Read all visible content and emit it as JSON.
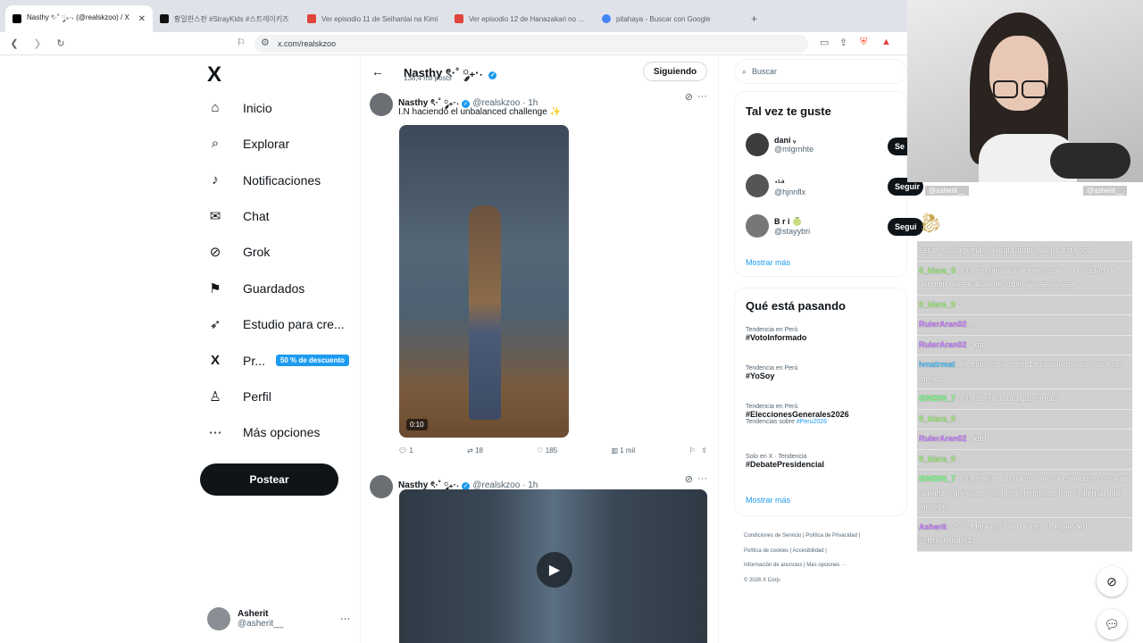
{
  "browser": {
    "tabs": [
      {
        "title": "Nasthy ৎ·˚ ༘₊·˖ (@realskzoo) / X",
        "active": true,
        "fav_color": "#000000"
      },
      {
        "title": "황밀한스판 #StrayKids #스트레이키즈",
        "active": false,
        "fav_color": "#111111"
      },
      {
        "title": "Ver episodio 11 de Seihantai na Kimi",
        "active": false,
        "fav_color": "#e0443a"
      },
      {
        "title": "Ver episodio 12 de Hanazakari no Kimi",
        "active": false,
        "fav_color": "#e0443a"
      },
      {
        "title": "pitahaya - Buscar con Google",
        "active": false,
        "fav_color": "#4285f4"
      }
    ],
    "new_tab": "+",
    "url": "x.com/realskzoo"
  },
  "nav": {
    "logo": "X",
    "items": [
      {
        "label": "Inicio",
        "icon": "⌂"
      },
      {
        "label": "Explorar",
        "icon": "⌕"
      },
      {
        "label": "Notificaciones",
        "icon": "♪"
      },
      {
        "label": "Chat",
        "icon": "✉"
      },
      {
        "label": "Grok",
        "icon": "⊘"
      },
      {
        "label": "Guardados",
        "icon": "⚑"
      },
      {
        "label": "Estudio para cre...",
        "icon": "➶"
      },
      {
        "label": "Pr...",
        "icon": "X",
        "badge": "50 % de descuento"
      },
      {
        "label": "Perfil",
        "icon": "♙"
      },
      {
        "label": "Más opciones",
        "icon": "⋯"
      }
    ],
    "post_button": "Postear",
    "account": {
      "name": "Asherit",
      "handle": "@asherit__",
      "more": "···"
    }
  },
  "profile": {
    "name": "Nasthy ৎ·˚ ༘₊·˖",
    "posts": "138,4 mil posts",
    "follow_label": "Siguiendo"
  },
  "tweets": [
    {
      "name": "Nasthy ৎ·˚ ༘₊·˖",
      "handle": "@realskzoo",
      "time": "· 1h",
      "text": "I.N haciendo el unbalanced challenge ✨",
      "duration": "0:10",
      "replies": "1",
      "retweets": "18",
      "likes": "185",
      "views": "1 mil"
    },
    {
      "name": "Nasthy ৎ·˚ ༘₊·˖",
      "handle": "@realskzoo",
      "time": "· 1h"
    }
  ],
  "sidebar": {
    "search_placeholder": "Buscar",
    "suggest_title": "Tal vez te guste",
    "suggestions": [
      {
        "name": "dani ᵥ",
        "handle": "@mlgrnhte",
        "button": "Se"
      },
      {
        "name": "･ᴸᵃ",
        "handle": "@hjnnflx",
        "button": "Seguir"
      },
      {
        "name": "B r i 🍈",
        "handle": "@stayybri",
        "button": "Segui"
      }
    ],
    "show_more": "Mostrar más",
    "trends_title": "Qué está pasando",
    "trends": [
      {
        "context": "Tendencia en Perú",
        "topic": "#VotoInformado"
      },
      {
        "context": "Tendencia en Perú",
        "topic": "#YoSoy"
      },
      {
        "context": "Tendencia en Perú",
        "topic": "#EleccionesGenerales2026",
        "sub_prefix": "Tendencias sobre",
        "sub_link": "#Peru2026"
      },
      {
        "context": "Solo en X · Tendencia",
        "topic": "#DebatePresidencial"
      }
    ],
    "trends_more": "Mostrar más",
    "footer": [
      "Condiciones de Servicio  |  Política de Privacidad  |",
      "Política de cookies  |  Accesibilidad  |",
      "Información de anuncios  |  Más opciones ···",
      "© 2026 X Corp."
    ]
  },
  "stream": {
    "cam_labels": [
      "@asherit__",
      "@asherit__"
    ],
    "chat": [
      {
        "user": "",
        "text": "secar sus lágrimas, asegurando que no esta sola",
        "color": "#ffffff"
      },
      {
        "user": "0_kiara_0",
        "text": ": @Asherit jajajaja tienes que ver el video de Jeongin que acaban de subir ajjajajajajajaja",
        "color": "#9ef07a"
      },
      {
        "user": "0_kiara_0",
        "text": ":",
        "color": "#9ef07a"
      },
      {
        "user": "RulerAran02",
        "text": ": ..",
        "color": "#c77dff"
      },
      {
        "user": "RulerAran02",
        "text": ": xdd",
        "color": "#c77dff"
      },
      {
        "user": "lvnatrmat",
        "text": ": hemos visto comp 15 conciertos en vivo esos meses",
        "color": "#4fc3ff"
      },
      {
        "user": "BINBIN_7",
        "text": ": @Asherit ahora que sigue?",
        "color": "#7dff8a"
      },
      {
        "user": "0_kiara_0",
        "text": ":",
        "color": "#9ef07a"
      },
      {
        "user": "RulerAran02",
        "text": ": xdd",
        "color": "#c77dff"
      },
      {
        "user": "0_kiara_0",
        "text": ":",
        "color": "#9ef07a"
      },
      {
        "user": "BINBIN_7",
        "text": ": @Asherit que hago? me da comezón cerca de la nariz y ahi es donde tengo hinchado por el animal que me pico",
        "color": "#7dff8a"
      },
      {
        "user": "Asherit",
        "text": ": 'Soy Migajero' de Raymix (Requested by @RulerAran02)",
        "color": "#c77dff"
      },
      {
        "user": "RulerAran02",
        "text": ":",
        "color": "#c77dff"
      }
    ]
  }
}
